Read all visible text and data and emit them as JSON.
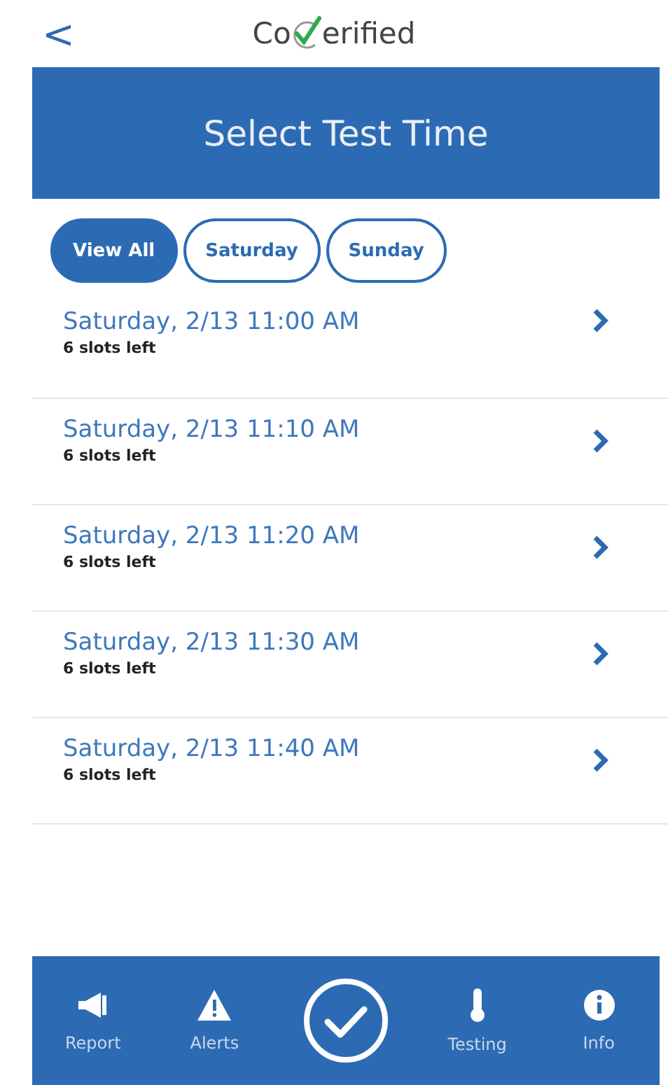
{
  "header": {
    "back": "<",
    "logo_start": "Co",
    "logo_end": "erified"
  },
  "banner": {
    "title": "Select Test Time"
  },
  "filters": [
    {
      "label": "View All",
      "selected": true
    },
    {
      "label": "Saturday",
      "selected": false
    },
    {
      "label": "Sunday",
      "selected": false
    }
  ],
  "slots": [
    {
      "time": "Saturday, 2/13 11:00 AM",
      "availability": "6 slots left"
    },
    {
      "time": "Saturday, 2/13 11:10 AM",
      "availability": "6 slots left"
    },
    {
      "time": "Saturday, 2/13 11:20 AM",
      "availability": "6 slots left"
    },
    {
      "time": "Saturday, 2/13 11:30 AM",
      "availability": "6 slots left"
    },
    {
      "time": "Saturday, 2/13 11:40 AM",
      "availability": "6 slots left"
    }
  ],
  "nav": [
    {
      "kind": "megaphone",
      "label": "Report"
    },
    {
      "kind": "alert",
      "label": "Alerts"
    },
    {
      "kind": "check"
    },
    {
      "kind": "thermometer",
      "label": "Testing"
    },
    {
      "kind": "info",
      "label": "Info"
    }
  ]
}
